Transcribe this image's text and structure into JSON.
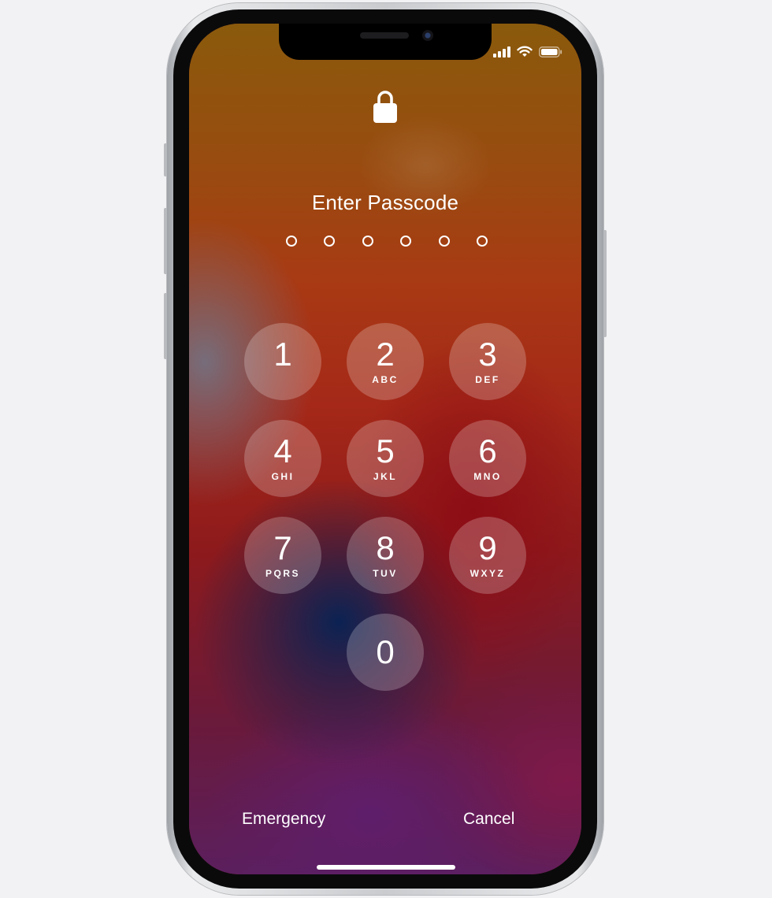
{
  "screen": {
    "prompt": "Enter Passcode",
    "passcode_length": 6,
    "entered_digits": 0
  },
  "status_bar": {
    "icons": [
      "cellular-signal-icon",
      "wifi-icon",
      "battery-icon"
    ]
  },
  "lock_icon": "lock-icon",
  "keypad": {
    "keys": [
      {
        "digit": "1",
        "letters": ""
      },
      {
        "digit": "2",
        "letters": "ABC"
      },
      {
        "digit": "3",
        "letters": "DEF"
      },
      {
        "digit": "4",
        "letters": "GHI"
      },
      {
        "digit": "5",
        "letters": "JKL"
      },
      {
        "digit": "6",
        "letters": "MNO"
      },
      {
        "digit": "7",
        "letters": "PQRS"
      },
      {
        "digit": "8",
        "letters": "TUV"
      },
      {
        "digit": "9",
        "letters": "WXYZ"
      },
      {
        "digit": "0",
        "letters": ""
      }
    ]
  },
  "actions": {
    "emergency_label": "Emergency",
    "cancel_label": "Cancel"
  },
  "colors": {
    "key_fill": "rgba(255,255,255,0.22)",
    "text": "#ffffff"
  }
}
